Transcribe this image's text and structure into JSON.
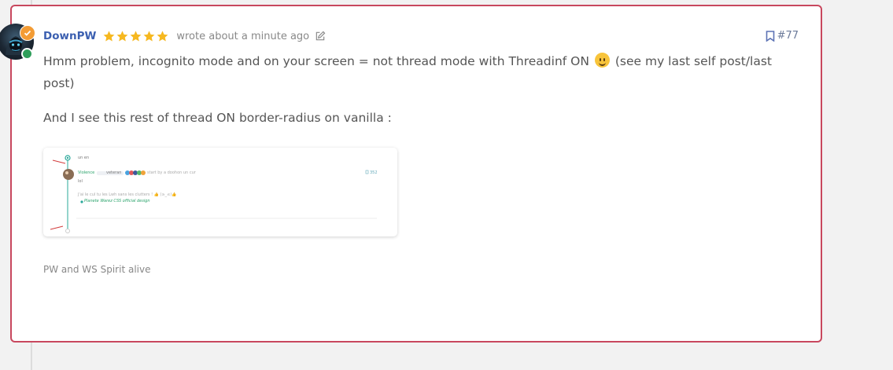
{
  "post": {
    "author": "DownPW",
    "rating_stars": 5,
    "meta": "wrote about a minute ago",
    "index": "#77",
    "paragraph1": "Hmm problem, incognito mode and on your screen = not thread mode with Threadinf ON",
    "paragraph1_after": "(see my last self post/last post)",
    "paragraph2": "And I see this rest of thread ON border-radius on vanilla :",
    "signature": "PW and WS Spirit alive"
  },
  "embed": {
    "line1": "un en",
    "user": "Violence",
    "badge": "veteran",
    "meta": "start by a doohon un cur",
    "index": "352",
    "body": "lol",
    "sig1": "J'ai le cul tu les Lwh sans les clutters ! 👍 (≥_≤)👍",
    "sig2": "Planete Warez CSS official design"
  },
  "colors": {
    "card_border": "#c8485e",
    "username": "#3b5fb0",
    "star": "#f6b820",
    "mod_badge": "#f39c35",
    "online": "#2f9e5a"
  },
  "icons": [
    "star-icon",
    "edit-icon",
    "bookmark-icon",
    "check-icon",
    "smiley-icon"
  ]
}
